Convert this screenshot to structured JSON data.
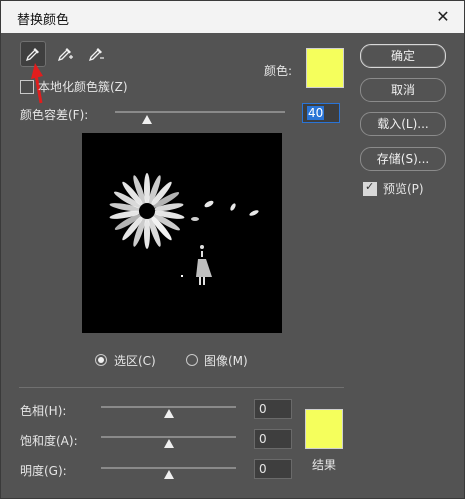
{
  "window": {
    "title": "替换颜色",
    "close_glyph": "✕"
  },
  "tools": [
    {
      "name": "eyedropper",
      "active": true
    },
    {
      "name": "eyedropper-plus",
      "active": false
    },
    {
      "name": "eyedropper-minus",
      "active": false
    }
  ],
  "localized_clusters": {
    "label": "本地化颜色簇(Z)",
    "checked": false
  },
  "color": {
    "label": "颜色:",
    "swatch": "#f5ff5c"
  },
  "fuzziness": {
    "label": "颜色容差(F):",
    "value": "40",
    "slider_percent": 20
  },
  "buttons": {
    "ok": "确定",
    "cancel": "取消",
    "load": "载入(L)...",
    "save": "存储(S)...",
    "preview_label": "预览(P)",
    "preview_checked": true
  },
  "view_mode": {
    "selection": "选区(C)",
    "image": "图像(M)",
    "selected": "selection"
  },
  "adjust": {
    "hue": {
      "label": "色相(H):",
      "value": "0"
    },
    "saturation": {
      "label": "饱和度(A):",
      "value": "0"
    },
    "lightness": {
      "label": "明度(G):",
      "value": "0"
    }
  },
  "result": {
    "label": "结果",
    "swatch": "#f5ff5c"
  }
}
